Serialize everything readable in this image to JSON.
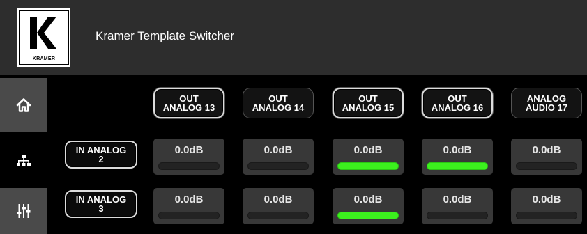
{
  "header": {
    "logo_text": "KRAMER",
    "title": "Kramer Template Switcher"
  },
  "sidebar": [
    {
      "name": "home-icon",
      "color": "#ffffff"
    },
    {
      "name": "network-icon",
      "color": "#ffffff"
    },
    {
      "name": "mixer-sliders-icon",
      "color": "#ffffff"
    }
  ],
  "outputs": [
    {
      "line1": "OUT",
      "line2": "ANALOG 13",
      "selected": true
    },
    {
      "line1": "OUT",
      "line2": "ANALOG 14",
      "selected": false
    },
    {
      "line1": "OUT",
      "line2": "ANALOG 15",
      "selected": true
    },
    {
      "line1": "OUT",
      "line2": "ANALOG 16",
      "selected": true
    },
    {
      "line1": "ANALOG",
      "line2": "AUDIO 17",
      "selected": false
    }
  ],
  "inputs": [
    {
      "line1": "IN ANALOG",
      "line2": "2",
      "cells": [
        {
          "value": "0.0dB",
          "active": false
        },
        {
          "value": "0.0dB",
          "active": false
        },
        {
          "value": "0.0dB",
          "active": true
        },
        {
          "value": "0.0dB",
          "active": true
        },
        {
          "value": "0.0dB",
          "active": false
        }
      ]
    },
    {
      "line1": "IN ANALOG",
      "line2": "3",
      "cells": [
        {
          "value": "0.0dB",
          "active": false
        },
        {
          "value": "0.0dB",
          "active": false
        },
        {
          "value": "0.0dB",
          "active": true
        },
        {
          "value": "0.0dB",
          "active": false
        },
        {
          "value": "0.0dB",
          "active": false
        }
      ]
    }
  ],
  "colors": {
    "header_bg": "#2d2d2d",
    "sidebar_bg": "#4a4a4a",
    "cell_bg": "#383838",
    "active_bar": "#3cf01e"
  }
}
